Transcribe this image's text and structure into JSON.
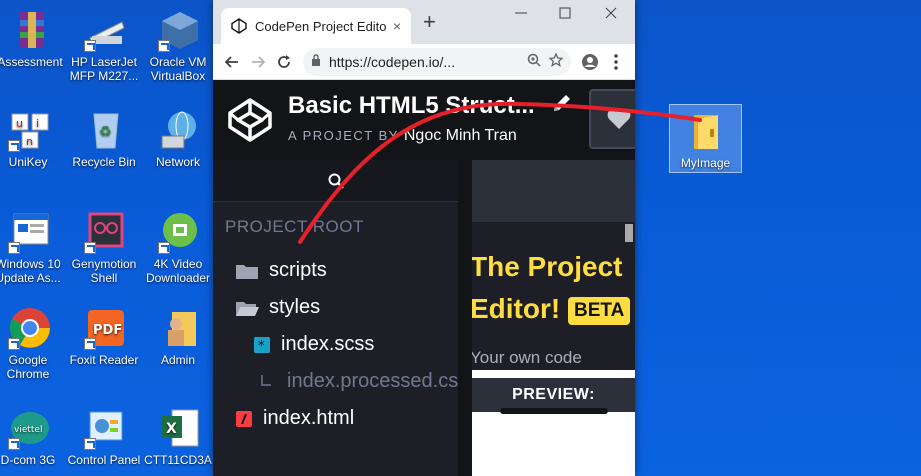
{
  "desktop": {
    "icons": [
      {
        "label": "Assessment"
      },
      {
        "label": "HP LaserJet MFP M227..."
      },
      {
        "label": "Oracle VM VirtualBox"
      },
      {
        "label": "UniKey"
      },
      {
        "label": "Recycle Bin"
      },
      {
        "label": "Network"
      },
      {
        "label": "Windows 10 Update As..."
      },
      {
        "label": "Genymotion Shell"
      },
      {
        "label": "4K Video Downloader"
      },
      {
        "label": "Google Chrome"
      },
      {
        "label": "Foxit Reader"
      },
      {
        "label": "Admin"
      },
      {
        "label": "D-com 3G"
      },
      {
        "label": "Control Panel"
      },
      {
        "label": "CTT11CD3A"
      }
    ],
    "folder": {
      "label": "MyImage"
    }
  },
  "browser": {
    "tab_title": "CodePen Project Editor",
    "url": "https://codepen.io/...",
    "new_tab_symbol": "+",
    "close_symbol": "×"
  },
  "codepen": {
    "project_title": "Basic HTML5 Struct...",
    "by_prefix": "A PROJECT BY",
    "author": "Ngoc Minh Tran"
  },
  "sidebar": {
    "root_label": "PROJECT ROOT",
    "tree": [
      {
        "label": "scripts",
        "type": "folder"
      },
      {
        "label": "styles",
        "type": "folder-open"
      },
      {
        "label": "index.scss",
        "type": "scss"
      },
      {
        "label": "index.processed.css",
        "type": "processed"
      },
      {
        "label": "index.html",
        "type": "html"
      }
    ]
  },
  "preview": {
    "promo_line1": "The Project",
    "promo_line2": "Editor!",
    "beta_badge": "BETA",
    "promo_sub": "Your own code",
    "preview_label": "PREVIEW:"
  },
  "colors": {
    "desktop_blue": "#0a5ad6",
    "codepen_dark": "#131417",
    "promo_yellow": "#ffdd40",
    "arrow_red": "#e8202a"
  }
}
